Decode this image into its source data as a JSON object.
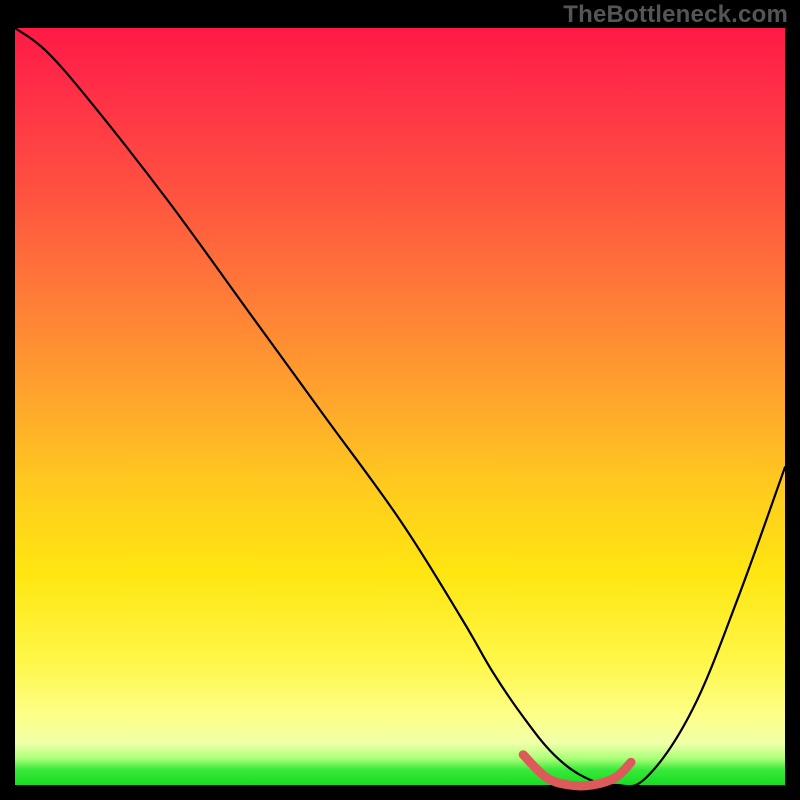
{
  "watermark": "TheBottleneck.com",
  "chart_data": {
    "type": "line",
    "title": "",
    "xlabel": "",
    "ylabel": "",
    "xlim": [
      0,
      100
    ],
    "ylim": [
      0,
      100
    ],
    "grid": false,
    "legend": false,
    "series": [
      {
        "name": "main-curve",
        "color": "#000000",
        "x": [
          0,
          4,
          10,
          20,
          30,
          40,
          50,
          58,
          62,
          66,
          70,
          74,
          78,
          82,
          88,
          94,
          100
        ],
        "values": [
          100,
          97,
          90,
          77,
          63,
          49,
          35,
          22,
          15,
          9,
          4,
          1,
          0,
          1,
          10,
          25,
          42
        ]
      },
      {
        "name": "valley-highlight",
        "color": "#e05a5a",
        "x": [
          66,
          69,
          72,
          75,
          78,
          80
        ],
        "values": [
          4,
          1,
          0,
          0,
          1,
          3
        ]
      }
    ],
    "annotations": []
  }
}
